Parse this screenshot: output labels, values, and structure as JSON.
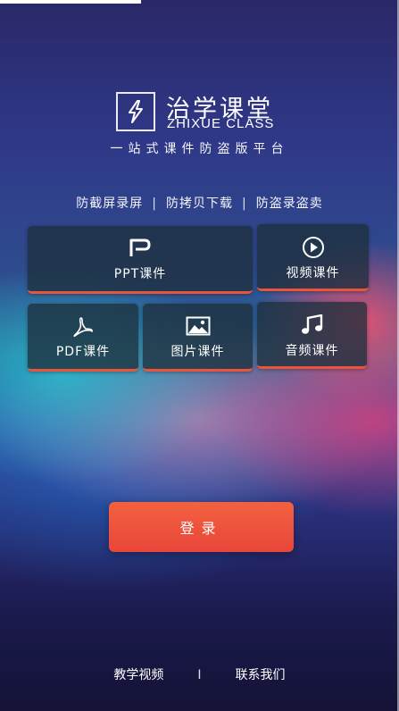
{
  "brand": {
    "name_cn": "治学课堂",
    "name_en": "ZHIXUE CLASS",
    "tagline": "一站式课件防盗版平台",
    "logo_icon": "lightning-bolt-icon"
  },
  "features": {
    "items": [
      "防截屏录屏",
      "防拷贝下载",
      "防盗录盗卖"
    ],
    "separator": "|"
  },
  "tiles": {
    "ppt": {
      "label": "PPT课件",
      "icon": "ppt-p-icon"
    },
    "video": {
      "label": "视频课件",
      "icon": "play-circle-icon"
    },
    "pdf": {
      "label": "PDF课件",
      "icon": "pdf-acrobat-icon"
    },
    "image": {
      "label": "图片课件",
      "icon": "image-icon"
    },
    "audio": {
      "label": "音频课件",
      "icon": "music-note-icon"
    }
  },
  "login": {
    "label": "登录"
  },
  "footer": {
    "video_link": "教学视频",
    "divider": "I",
    "contact_link": "联系我们"
  },
  "colors": {
    "accent": "#e9463a",
    "tile_bg": "#1e303c"
  }
}
